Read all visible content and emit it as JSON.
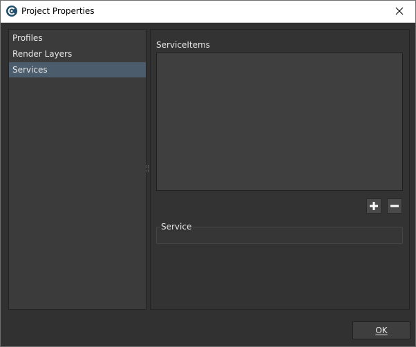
{
  "window": {
    "title": "Project Properties"
  },
  "sidebar": {
    "items": [
      {
        "label": "Profiles",
        "selected": false
      },
      {
        "label": "Render Layers",
        "selected": false
      },
      {
        "label": "Services",
        "selected": true
      }
    ]
  },
  "services": {
    "list_label": "ServiceItems",
    "group_label": "Service",
    "add_icon": "plus-icon",
    "remove_icon": "minus-icon"
  },
  "footer": {
    "ok_label": "OK"
  },
  "colors": {
    "selection": "#4b5d6c",
    "panel_bg": "#3b3b3b",
    "window_bg": "#313131"
  }
}
